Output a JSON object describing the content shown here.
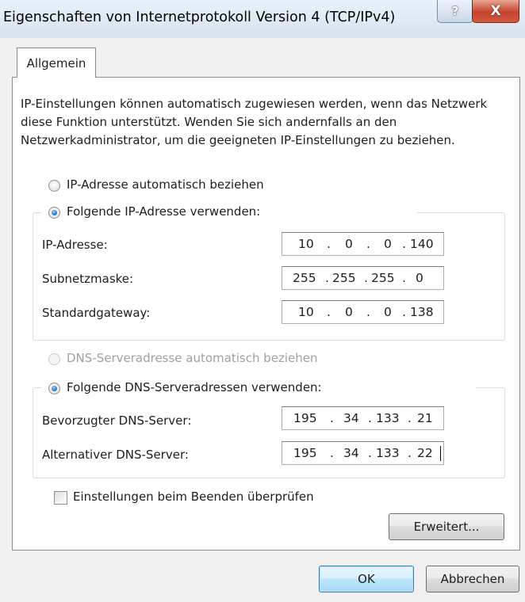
{
  "window": {
    "title": "Eigenschaften von Internetprotokoll Version 4 (TCP/IPv4)",
    "help_label": "?",
    "close_label": "X"
  },
  "tab": {
    "label": "Allgemein"
  },
  "description": "IP-Einstellungen können automatisch zugewiesen werden, wenn das Netzwerk diese Funktion unterstützt. Wenden Sie sich andernfalls an den Netzwerkadministrator, um die geeigneten IP-Einstellungen zu beziehen.",
  "ip": {
    "auto_label": "IP-Adresse automatisch beziehen",
    "manual_label": "Folgende IP-Adresse verwenden:",
    "selected": "manual",
    "fields": [
      {
        "label": "IP-Adresse:",
        "octets": [
          "10",
          "0",
          "0",
          "140"
        ]
      },
      {
        "label": "Subnetzmaske:",
        "octets": [
          "255",
          "255",
          "255",
          "0"
        ]
      },
      {
        "label": "Standardgateway:",
        "octets": [
          "10",
          "0",
          "0",
          "138"
        ]
      }
    ]
  },
  "dns": {
    "auto_label": "DNS-Serveradresse automatisch beziehen",
    "manual_label": "Folgende DNS-Serveradressen verwenden:",
    "selected": "manual",
    "fields": [
      {
        "label": "Bevorzugter DNS-Server:",
        "octets": [
          "195",
          "34",
          "133",
          "21"
        ]
      },
      {
        "label": "Alternativer DNS-Server:",
        "octets": [
          "195",
          "34",
          "133",
          "22"
        ]
      }
    ]
  },
  "validate_on_exit": {
    "label": "Einstellungen beim Beenden überprüfen",
    "checked": false
  },
  "buttons": {
    "advanced": "Erweitert...",
    "ok": "OK",
    "cancel": "Abbrechen"
  },
  "colors": {
    "default_button_border": "#3c7fb1",
    "close_button": "#c7432e"
  },
  "icons": {
    "help": "help-icon",
    "close": "close-icon"
  }
}
